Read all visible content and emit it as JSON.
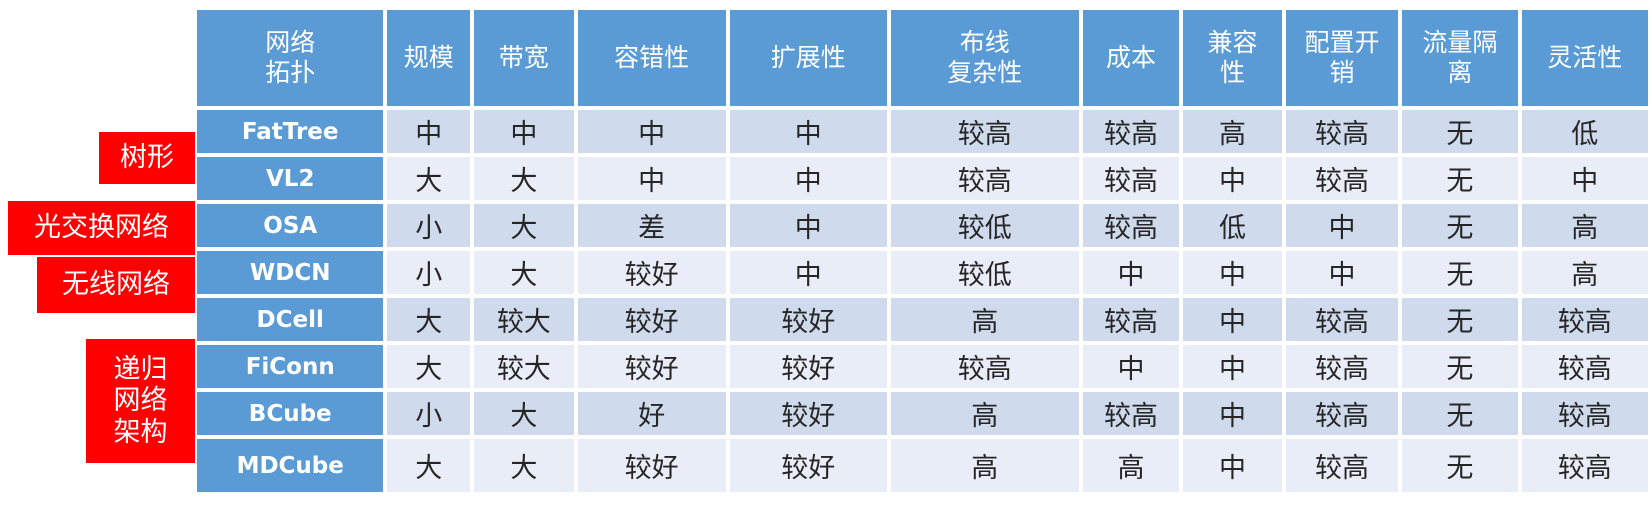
{
  "categories": [
    {
      "label": "树形"
    },
    {
      "label": "光交换网络"
    },
    {
      "label": "无线网络"
    },
    {
      "label": "递归\n网络\n架构"
    }
  ],
  "table": {
    "headers": [
      "网络\n拓扑",
      "规模",
      "带宽",
      "容错性",
      "扩展性",
      "布线\n复杂性",
      "成本",
      "兼容\n性",
      "配置开\n销",
      "流量隔\n离",
      "灵活性"
    ],
    "rows": [
      {
        "name": "FatTree",
        "cells": [
          "中",
          "中",
          "中",
          "中",
          "较高",
          "较高",
          "高",
          "较高",
          "无",
          "低"
        ]
      },
      {
        "name": "VL2",
        "cells": [
          "大",
          "大",
          "中",
          "中",
          "较高",
          "较高",
          "中",
          "较高",
          "无",
          "中"
        ]
      },
      {
        "name": "OSA",
        "cells": [
          "小",
          "大",
          "差",
          "中",
          "较低",
          "较高",
          "低",
          "中",
          "无",
          "高"
        ]
      },
      {
        "name": "WDCN",
        "cells": [
          "小",
          "大",
          "较好",
          "中",
          "较低",
          "中",
          "中",
          "中",
          "无",
          "高"
        ]
      },
      {
        "name": "DCell",
        "cells": [
          "大",
          "较大",
          "较好",
          "较好",
          "高",
          "较高",
          "中",
          "较高",
          "无",
          "较高"
        ]
      },
      {
        "name": "FiConn",
        "cells": [
          "大",
          "较大",
          "较好",
          "较好",
          "较高",
          "中",
          "中",
          "较高",
          "无",
          "较高"
        ]
      },
      {
        "name": "BCube",
        "cells": [
          "小",
          "大",
          "好",
          "较好",
          "高",
          "较高",
          "中",
          "较高",
          "无",
          "较高"
        ]
      },
      {
        "name": "MDCube",
        "cells": [
          "大",
          "大",
          "较好",
          "较好",
          "高",
          "高",
          "中",
          "较高",
          "无",
          "较高"
        ]
      }
    ]
  }
}
